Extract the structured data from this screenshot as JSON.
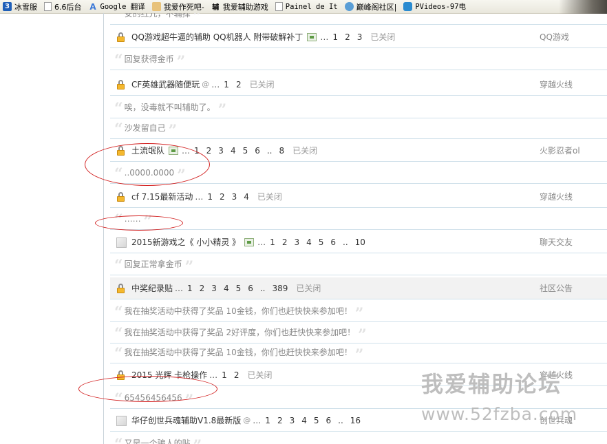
{
  "bookmarks": [
    {
      "icon": "number-3-icon",
      "glyph": "3",
      "label": "冰雪服"
    },
    {
      "icon": "page-icon",
      "glyph": "",
      "label": "6.6后台"
    },
    {
      "icon": "google-translate-icon",
      "glyph": "A",
      "label": "Google 翻译"
    },
    {
      "icon": "image-icon",
      "glyph": "",
      "label": "我爱作死吧-"
    },
    {
      "icon": "text-icon",
      "glyph": "辅",
      "label": "我爱辅助游戏"
    },
    {
      "icon": "page-icon",
      "glyph": "",
      "label": "Painel de It"
    },
    {
      "icon": "globe-icon",
      "glyph": "",
      "label": "巅峰阁社区|"
    },
    {
      "icon": "pvideos-icon",
      "glyph": "",
      "label": "PVideos-97电"
    }
  ],
  "top_cut_reply": "安的红亢，不辅择",
  "rows": [
    {
      "kind": "thread",
      "icon": "lock-icon",
      "title": "QQ游戏超牛逼的辅助 QQ机器人 附带破解补丁",
      "image": true,
      "attach": false,
      "pages": [
        "1",
        "2",
        "3"
      ],
      "closed": "已关闭",
      "forum": "QQ游戏"
    },
    {
      "kind": "reply",
      "text": "回复获得金币"
    },
    {
      "kind": "thread",
      "icon": "lock-icon",
      "title": "CF英雄武器随便玩",
      "image": false,
      "attach": true,
      "pages": [
        "1",
        "2"
      ],
      "closed": "已关闭",
      "forum": "穿越火线"
    },
    {
      "kind": "reply",
      "text": "唉，没毒就不叫辅助了。"
    },
    {
      "kind": "reply",
      "text": "沙发留自己"
    },
    {
      "kind": "thread",
      "icon": "lock-icon",
      "title": "土流氓队",
      "image": true,
      "attach": false,
      "pages": [
        "1",
        "2",
        "3",
        "4",
        "5",
        "6",
        "..",
        "8"
      ],
      "closed": "已关闭",
      "forum": "火影忍者ol"
    },
    {
      "kind": "reply",
      "text": "..0000.0000"
    },
    {
      "kind": "thread",
      "icon": "lock-icon",
      "title": "cf 7.15最新活动",
      "image": false,
      "attach": false,
      "pages": [
        "1",
        "2",
        "3",
        "4"
      ],
      "closed": "已关闭",
      "forum": "穿越火线"
    },
    {
      "kind": "reply",
      "text": "……"
    },
    {
      "kind": "thread",
      "icon": "folder-icon",
      "title": "2015新游戏之《 小小精灵 》",
      "image": true,
      "attach": false,
      "pages": [
        "1",
        "2",
        "3",
        "4",
        "5",
        "6",
        "..",
        "10"
      ],
      "closed": "",
      "forum": "聊天交友"
    },
    {
      "kind": "reply",
      "text": "回复正常拿金币"
    },
    {
      "kind": "thread",
      "icon": "lock-icon",
      "title": "中奖纪录贴",
      "image": false,
      "attach": false,
      "pages": [
        "1",
        "2",
        "3",
        "4",
        "5",
        "6",
        "..",
        "389"
      ],
      "closed": "已关闭",
      "forum": "社区公告",
      "sticky": true
    },
    {
      "kind": "reply",
      "text": "我在抽奖活动中获得了奖品 10金钱，你们也赶快快来参加吧！"
    },
    {
      "kind": "reply",
      "text": "我在抽奖活动中获得了奖品 2好评度，你们也赶快快来参加吧！"
    },
    {
      "kind": "reply",
      "text": "我在抽奖活动中获得了奖品 10金钱，你们也赶快快来参加吧！"
    },
    {
      "kind": "thread",
      "icon": "lock-icon",
      "title": "2015 光辉 卡枪操作",
      "image": false,
      "attach": false,
      "pages": [
        "1",
        "2"
      ],
      "closed": "已关闭",
      "forum": "穿越火线"
    },
    {
      "kind": "reply",
      "text": "65456456456"
    },
    {
      "kind": "thread",
      "icon": "folder-icon",
      "title": "华仔创世兵魂辅助V1.8最新版",
      "image": false,
      "attach": true,
      "pages": [
        "1",
        "2",
        "3",
        "4",
        "5",
        "6",
        "..",
        "16"
      ],
      "closed": "",
      "forum": "创世兵魂"
    },
    {
      "kind": "reply",
      "text": "又是一个骗人的贴"
    }
  ],
  "ellipsis": "…",
  "attach_glyph": "@",
  "quote_open": "“",
  "quote_close": "”",
  "watermark": {
    "name": "我爱辅助论坛",
    "url": "www.52fzba.com"
  },
  "annotation_color": "#d21f1f"
}
